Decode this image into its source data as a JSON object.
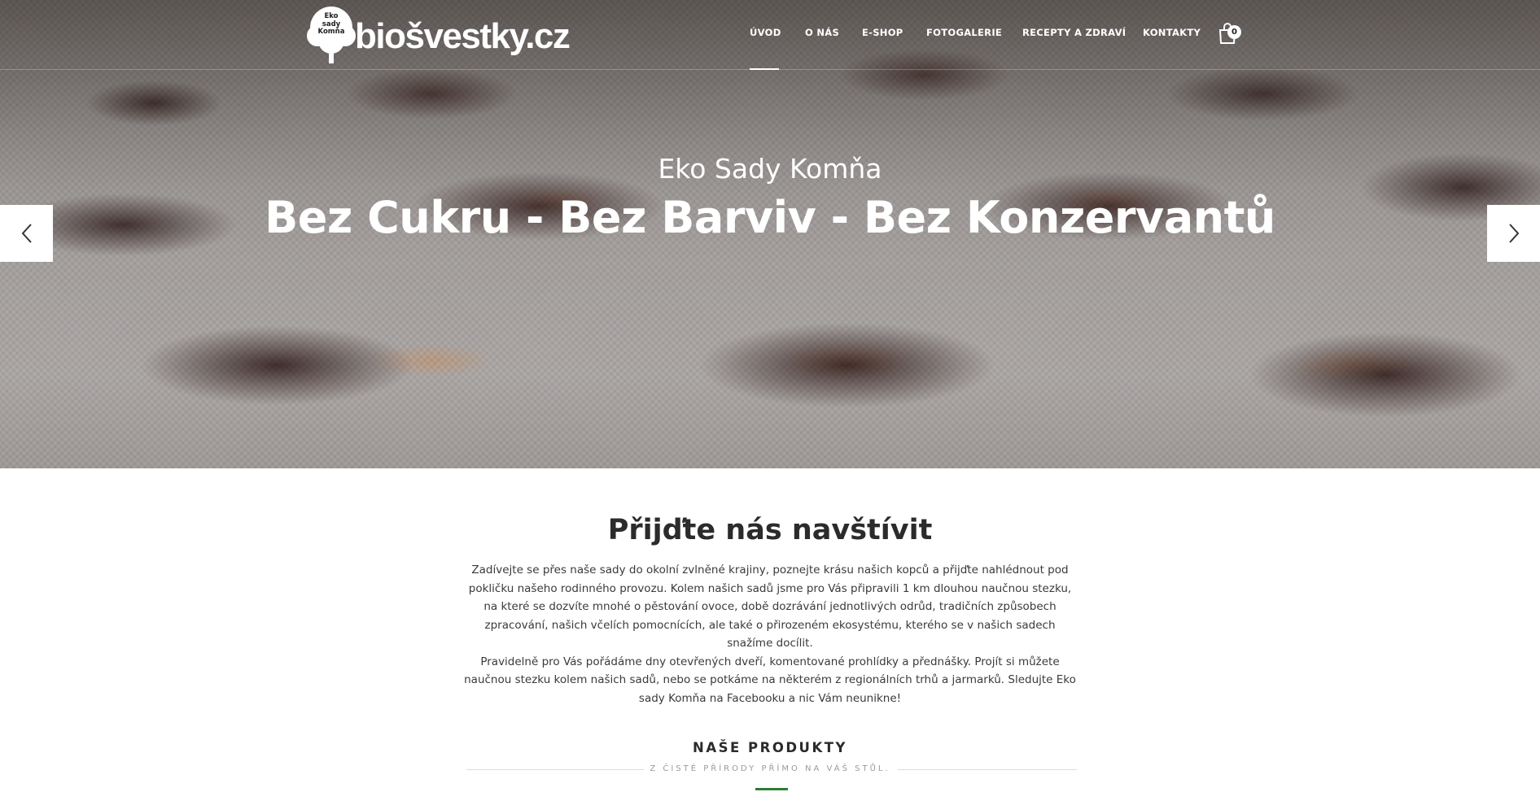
{
  "brand": {
    "logo_tree_text": "Eko\nsady\nKomňa",
    "logo_word": "biošvestky.cz"
  },
  "nav": {
    "items": [
      {
        "label": "ÚVOD",
        "active": true
      },
      {
        "label": "O NÁS"
      },
      {
        "label": "E-SHOP"
      },
      {
        "label": "FOTOGALERIE"
      },
      {
        "label": "RECEPTY A ZDRAVÍ"
      },
      {
        "label": "KONTAKTY"
      }
    ],
    "cart_count": "0"
  },
  "hero": {
    "subtitle": "Eko Sady Komňa",
    "title": "Bez Cukru - Bez Barviv - Bez Konzervantů"
  },
  "intro": {
    "title": "Přijďte nás navštívit",
    "paragraph1": "Zadívejte se přes naše sady do okolní zvlněné krajiny, poznejte krásu našich kopců a přijďte nahlédnout pod pokličku našeho rodinného provozu. Kolem našich sadů jsme pro Vás připravili 1 km dlouhou naučnou stezku, na které se dozvíte mnohé o pěstování ovoce, době dozrávání jednotlivých odrůd, tradičních způsobech zpracování, našich včelích pomocnících, ale také o přirozeném ekosystému, kterého se v našich sadech snažíme docílit.",
    "paragraph2": "Pravidelně pro Vás pořádáme dny otevřených dveří, komentované prohlídky a přednášky. Projít si můžete naučnou stezku kolem našich sadů, nebo se potkáme na některém z regionálních trhů a jarmarků. Sledujte Eko sady Komňa na Facebooku a nic Vám neunikne!"
  },
  "products": {
    "heading": "NAŠE PRODUKTY",
    "subheading": "Z ČISTÉ PŘÍRODY PŘÍMO NA VÁŠ STŮL."
  },
  "colors": {
    "accent_green": "#2e7d32",
    "text_dark": "#2b2b2b"
  }
}
